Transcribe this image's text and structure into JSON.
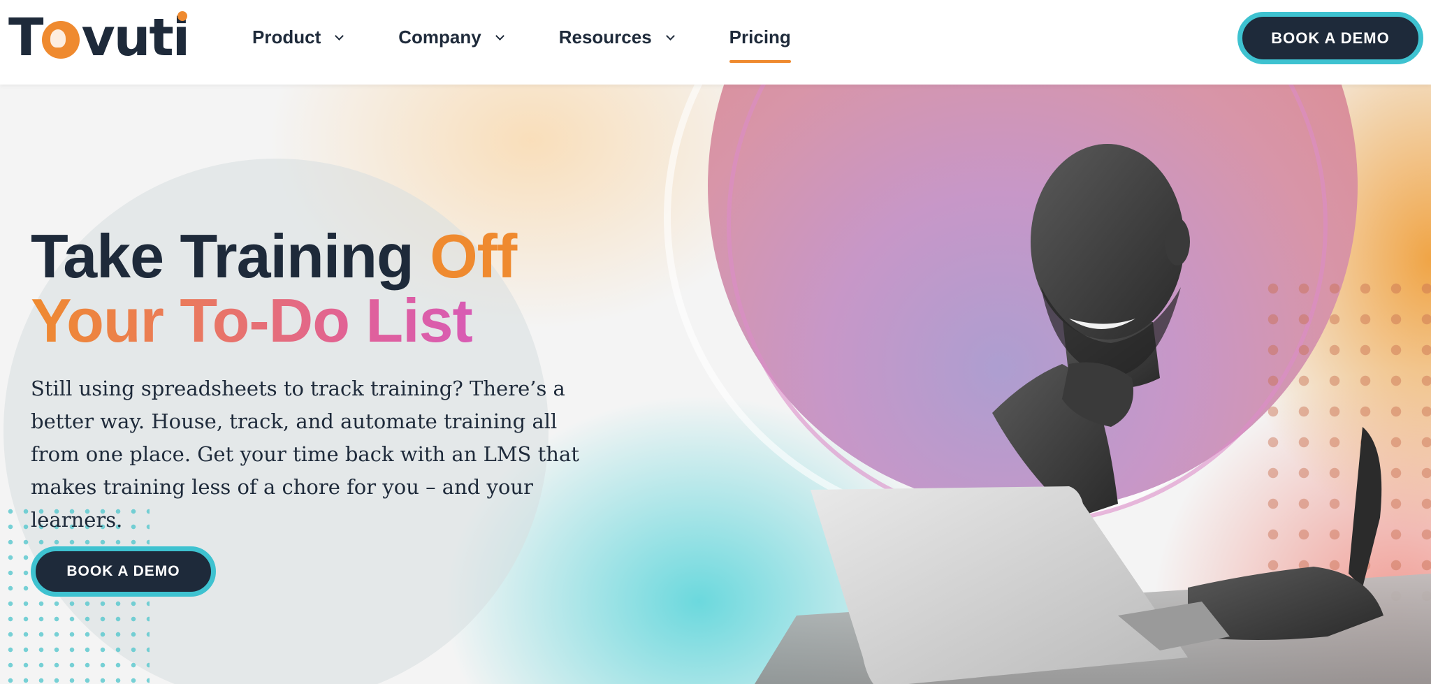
{
  "header": {
    "logo_text": "Tovuti",
    "nav": [
      {
        "label": "Product",
        "has_dropdown": true,
        "active": false
      },
      {
        "label": "Company",
        "has_dropdown": true,
        "active": false
      },
      {
        "label": "Resources",
        "has_dropdown": true,
        "active": false
      },
      {
        "label": "Pricing",
        "has_dropdown": false,
        "active": true
      }
    ],
    "cta_label": "BOOK A DEMO"
  },
  "hero": {
    "title_line1_dark": "Take Training ",
    "title_line1_accent": "Off",
    "title_line2_accent": "Your To-Do List",
    "body": "Still using spreadsheets to track training? There’s a better way. House, track, and automate training all from one place. Get your time back with an LMS that makes training less of a chore for you – and your learners.",
    "cta_label": "BOOK A DEMO"
  },
  "colors": {
    "navy": "#1e2a3a",
    "orange": "#ef8a2f",
    "pink": "#e0609a",
    "teal": "#3ec2d0"
  },
  "icons": [
    "chevron-down-icon",
    "elephant-logo-icon"
  ]
}
